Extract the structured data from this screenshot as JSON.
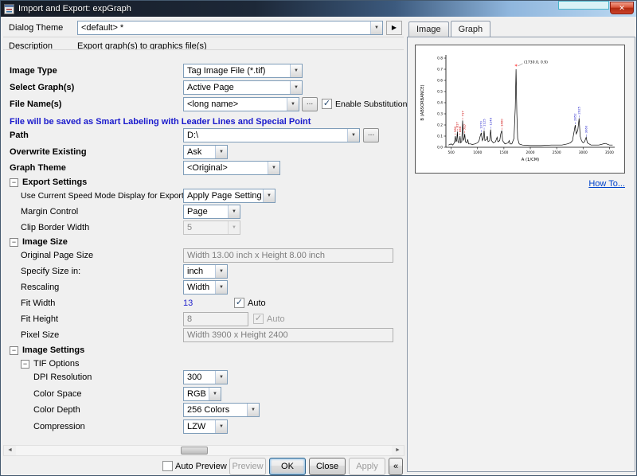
{
  "window": {
    "title": "Import and Export: expGraph"
  },
  "icons": {
    "dropdown_arrow": "▼",
    "browse_label": "...",
    "close": "✕",
    "flyout": "▶",
    "minus": "−",
    "check": "✓",
    "scroll_left": "◄",
    "scroll_right": "►"
  },
  "theme_bar": {
    "label": "Dialog Theme",
    "value": "<default> *"
  },
  "description": {
    "label": "Description",
    "value": "Export graph(s) to graphics file(s)"
  },
  "form": {
    "image_type": {
      "label": "Image Type",
      "value": "Tag Image File (*.tif)"
    },
    "select_graphs": {
      "label": "Select Graph(s)",
      "value": "Active Page"
    },
    "file_names": {
      "label": "File Name(s)",
      "value": "<long name>",
      "enable_substitution_label": "Enable Substitution",
      "enable_substitution_checked": true
    },
    "note": "File will be saved as Smart Labeling with Leader Lines and Special Point",
    "path": {
      "label": "Path",
      "value": "D:\\"
    },
    "overwrite": {
      "label": "Overwrite Existing",
      "value": "Ask"
    },
    "graph_theme": {
      "label": "Graph Theme",
      "value": "<Original>"
    },
    "export_settings": {
      "title": "Export Settings",
      "speed_mode": {
        "label": "Use Current Speed Mode Display for Export",
        "value": "Apply Page Setting"
      },
      "margin_control": {
        "label": "Margin Control",
        "value": "Page"
      },
      "clip_border": {
        "label": "Clip Border Width",
        "value": "5"
      }
    },
    "image_size": {
      "title": "Image Size",
      "original_page_size": {
        "label": "Original Page Size",
        "value": "Width 13.00 inch x Height 8.00 inch"
      },
      "specify_size_in": {
        "label": "Specify Size in:",
        "value": "inch"
      },
      "rescaling": {
        "label": "Rescaling",
        "value": "Width"
      },
      "fit_width": {
        "label": "Fit Width",
        "value": "13",
        "auto_label": "Auto",
        "auto_checked": true
      },
      "fit_height": {
        "label": "Fit Height",
        "value": "8",
        "auto_label": "Auto",
        "auto_checked": true
      },
      "pixel_size": {
        "label": "Pixel Size",
        "value": "Width 3900 x Height 2400"
      }
    },
    "image_settings": {
      "title": "Image Settings",
      "tif_options": {
        "title": "TIF Options",
        "dpi": {
          "label": "DPI Resolution",
          "value": "300"
        },
        "color_space": {
          "label": "Color Space",
          "value": "RGB"
        },
        "color_depth": {
          "label": "Color Depth",
          "value": "256 Colors"
        },
        "compression": {
          "label": "Compression",
          "value": "LZW"
        }
      }
    }
  },
  "footer": {
    "auto_preview_label": "Auto Preview",
    "auto_preview_checked": false,
    "preview": "Preview",
    "ok": "OK",
    "close": "Close",
    "apply": "Apply",
    "collapse": "«"
  },
  "preview": {
    "tabs": [
      "Image",
      "Graph"
    ],
    "active_tab": "Graph",
    "how_to": "How To..."
  },
  "chart_data": {
    "type": "line",
    "title": "",
    "xlabel": "A (1/CM)",
    "ylabel": "B (ABSORBANCE)",
    "xlim": [
      400,
      3600
    ],
    "ylim": [
      0,
      0.8
    ],
    "xticks": [
      500,
      1000,
      1500,
      2000,
      2500,
      3000,
      3500
    ],
    "yticks": [
      0.0,
      0.1,
      0.2,
      0.3,
      0.4,
      0.5,
      0.6,
      0.7,
      0.8
    ],
    "grid": false,
    "legend": "none",
    "line_color": "#000000",
    "x": [
      450,
      500,
      530,
      560,
      580,
      590,
      605,
      617,
      630,
      650,
      668,
      680,
      700,
      717,
      730,
      745,
      757,
      770,
      800,
      815,
      830,
      870,
      900,
      950,
      1000,
      1030,
      1050,
      1070,
      1090,
      1110,
      1125,
      1140,
      1170,
      1185,
      1200,
      1230,
      1249,
      1265,
      1300,
      1340,
      1370,
      1385,
      1420,
      1440,
      1460,
      1475,
      1520,
      1580,
      1600,
      1615,
      1650,
      1690,
      1715,
      1730,
      1745,
      1760,
      1790,
      1850,
      2000,
      2200,
      2400,
      2600,
      2700,
      2760,
      2800,
      2830,
      2852,
      2870,
      2900,
      2925,
      2945,
      2970,
      3000,
      3030,
      3060,
      3080,
      3150,
      3300,
      3420,
      3500,
      3560
    ],
    "y": [
      0.02,
      0.03,
      0.02,
      0.04,
      0.1,
      0.05,
      0.06,
      0.14,
      0.05,
      0.04,
      0.1,
      0.04,
      0.05,
      0.24,
      0.06,
      0.08,
      0.12,
      0.05,
      0.04,
      0.07,
      0.03,
      0.03,
      0.025,
      0.03,
      0.04,
      0.06,
      0.1,
      0.13,
      0.06,
      0.08,
      0.15,
      0.06,
      0.07,
      0.1,
      0.05,
      0.06,
      0.16,
      0.06,
      0.04,
      0.05,
      0.09,
      0.05,
      0.06,
      0.12,
      0.15,
      0.06,
      0.03,
      0.04,
      0.06,
      0.03,
      0.03,
      0.08,
      0.35,
      0.7,
      0.3,
      0.08,
      0.03,
      0.02,
      0.015,
      0.015,
      0.02,
      0.02,
      0.03,
      0.04,
      0.06,
      0.14,
      0.2,
      0.12,
      0.15,
      0.26,
      0.1,
      0.06,
      0.04,
      0.05,
      0.09,
      0.04,
      0.02,
      0.02,
      0.035,
      0.02,
      0.02
    ],
    "peak_labels": [
      {
        "x": 580,
        "y": 0.1,
        "text": "580",
        "color": "#cc0000"
      },
      {
        "x": 617,
        "y": 0.14,
        "text": "617",
        "color": "#cc0000"
      },
      {
        "x": 668,
        "y": 0.1,
        "text": "668",
        "color": "#cc0000"
      },
      {
        "x": 717,
        "y": 0.24,
        "text": "717",
        "color": "#cc0000"
      },
      {
        "x": 757,
        "y": 0.12,
        "text": "757",
        "color": "#cc0000"
      },
      {
        "x": 1070,
        "y": 0.13,
        "text": "1070",
        "color": "#2222cc"
      },
      {
        "x": 1125,
        "y": 0.15,
        "text": "1125",
        "color": "#2222cc"
      },
      {
        "x": 1249,
        "y": 0.16,
        "text": "1249",
        "color": "#2222cc"
      },
      {
        "x": 1460,
        "y": 0.15,
        "text": "1460",
        "color": "#cc0000"
      },
      {
        "x": 2852,
        "y": 0.2,
        "text": "2852",
        "color": "#2222cc"
      },
      {
        "x": 2925,
        "y": 0.26,
        "text": "2925",
        "color": "#2222cc"
      },
      {
        "x": 3060,
        "y": 0.09,
        "text": "3060",
        "color": "#2222cc"
      }
    ],
    "annotation": {
      "text": "(1730.0, 0.9)",
      "peak_x": 1730,
      "peak_y": 0.7,
      "label_x": 1880,
      "label_y": 0.755,
      "marker": "star",
      "marker_color": "#ff0000"
    }
  }
}
